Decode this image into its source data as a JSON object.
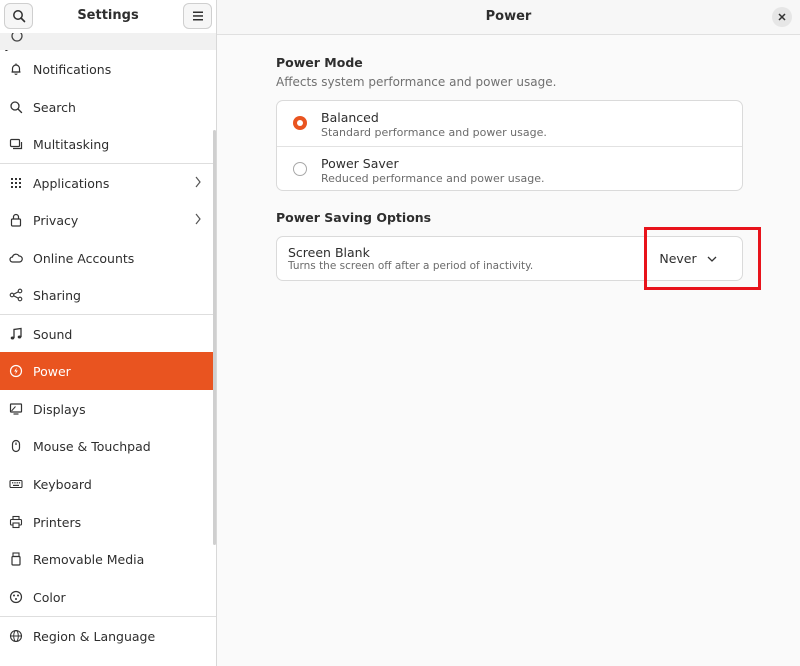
{
  "sidebar": {
    "title": "Settings",
    "items": [
      {
        "label": "Notifications",
        "icon": "bell-icon"
      },
      {
        "label": "Search",
        "icon": "search-icon"
      },
      {
        "label": "Multitasking",
        "icon": "multitasking-icon"
      },
      {
        "label": "Applications",
        "icon": "grid-icon",
        "has_submenu": true
      },
      {
        "label": "Privacy",
        "icon": "lock-icon",
        "has_submenu": true
      },
      {
        "label": "Online Accounts",
        "icon": "cloud-icon"
      },
      {
        "label": "Sharing",
        "icon": "share-icon"
      },
      {
        "label": "Sound",
        "icon": "music-note-icon"
      },
      {
        "label": "Power",
        "icon": "power-icon",
        "selected": true
      },
      {
        "label": "Displays",
        "icon": "display-icon"
      },
      {
        "label": "Mouse & Touchpad",
        "icon": "mouse-icon"
      },
      {
        "label": "Keyboard",
        "icon": "keyboard-icon"
      },
      {
        "label": "Printers",
        "icon": "printer-icon"
      },
      {
        "label": "Removable Media",
        "icon": "usb-icon"
      },
      {
        "label": "Color",
        "icon": "palette-icon"
      },
      {
        "label": "Region & Language",
        "icon": "globe-icon"
      }
    ]
  },
  "main": {
    "title": "Power",
    "power_mode": {
      "title": "Power Mode",
      "subtitle": "Affects system performance and power usage.",
      "options": [
        {
          "title": "Balanced",
          "subtitle": "Standard performance and power usage.",
          "selected": true
        },
        {
          "title": "Power Saver",
          "subtitle": "Reduced performance and power usage.",
          "selected": false
        }
      ]
    },
    "power_saving": {
      "title": "Power Saving Options",
      "screen_blank": {
        "title": "Screen Blank",
        "subtitle": "Turns the screen off after a period of inactivity.",
        "value": "Never"
      }
    }
  },
  "colors": {
    "accent": "#e95420",
    "highlight_box": "#e8131b"
  }
}
